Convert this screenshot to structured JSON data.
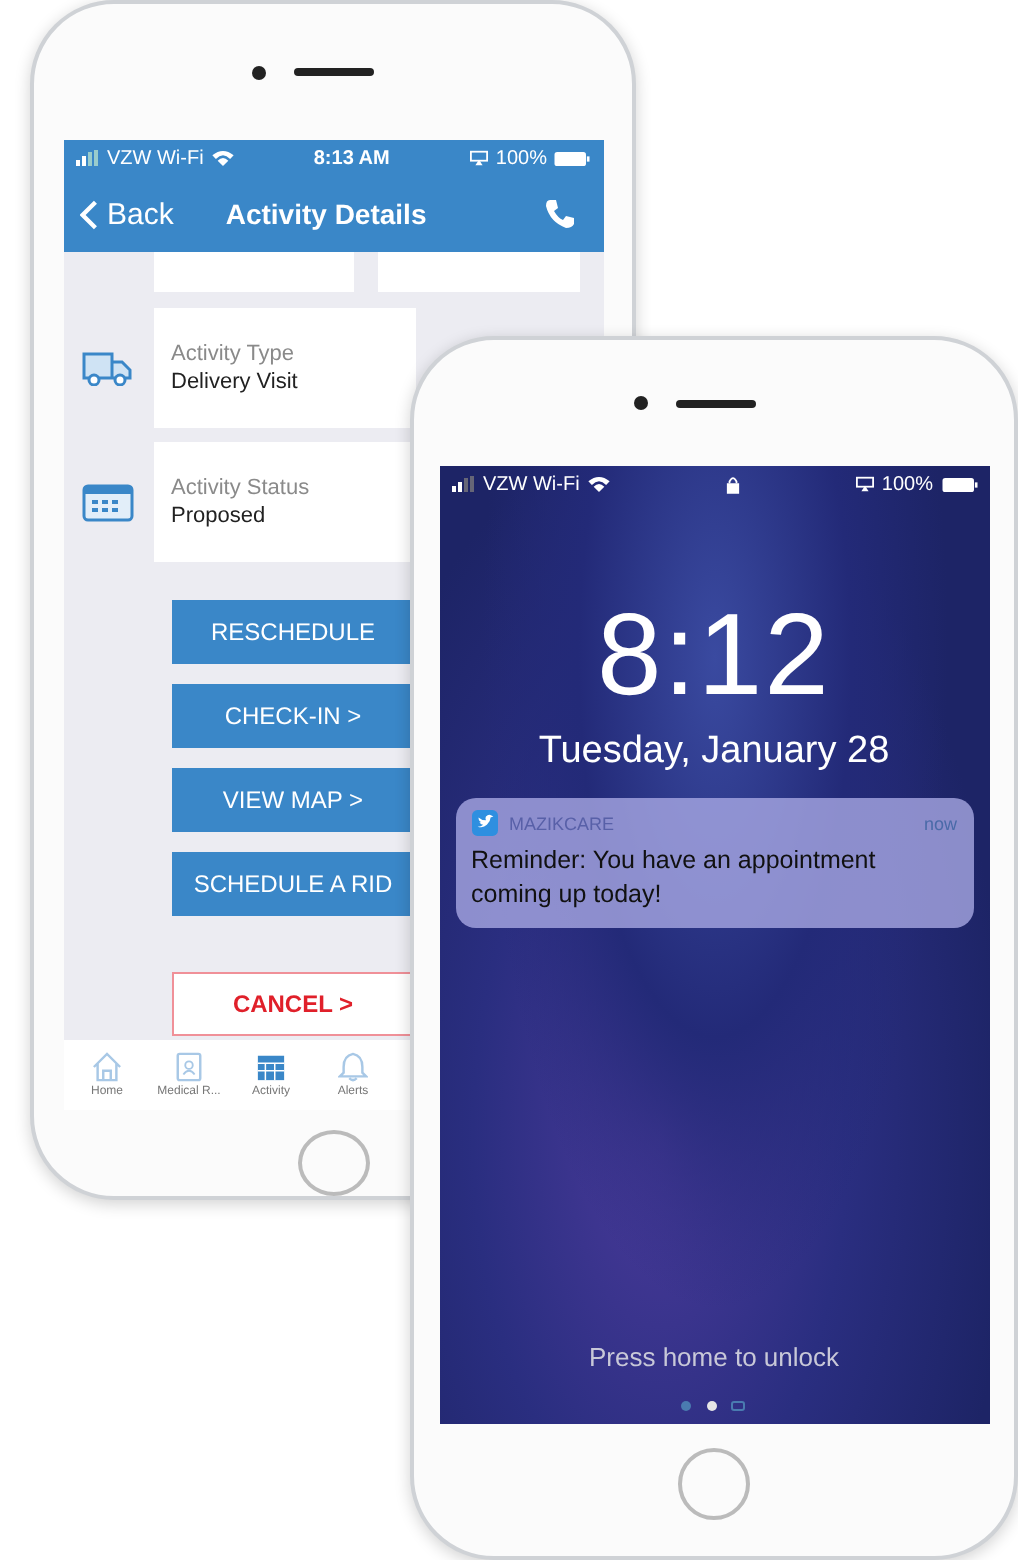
{
  "left_phone": {
    "status_bar": {
      "carrier": "VZW Wi-Fi",
      "time": "8:13 AM",
      "battery": "100%"
    },
    "nav_bar": {
      "back": "Back",
      "title": "Activity Details"
    },
    "details": [
      {
        "kind": "truck",
        "label": "Activity Type",
        "value": "Delivery Visit"
      },
      {
        "kind": "calendar",
        "label": "Activity Status",
        "value": "Proposed"
      }
    ],
    "actions": [
      {
        "kind": "primary",
        "label": "RESCHEDULE"
      },
      {
        "kind": "primary",
        "label": "CHECK-IN >"
      },
      {
        "kind": "primary",
        "label": "VIEW MAP >"
      },
      {
        "kind": "primary",
        "label": "SCHEDULE A RID"
      },
      {
        "kind": "danger",
        "label": "CANCEL >"
      }
    ],
    "tab_bar": [
      {
        "kind": "home",
        "label": "Home",
        "selected": false
      },
      {
        "kind": "record",
        "label": "Medical R...",
        "selected": false
      },
      {
        "kind": "calendar",
        "label": "Activity",
        "selected": true
      },
      {
        "kind": "bell",
        "label": "Alerts",
        "selected": false
      }
    ]
  },
  "right_phone": {
    "status_bar": {
      "carrier": "VZW Wi-Fi",
      "battery": "100%"
    },
    "clock": "8:12",
    "date": "Tuesday, January 28",
    "notification": {
      "app": "MAZIKCARE",
      "time": "now",
      "message": "Reminder: You have an appointment coming up today!"
    },
    "unlock_hint": "Press home to unlock"
  }
}
